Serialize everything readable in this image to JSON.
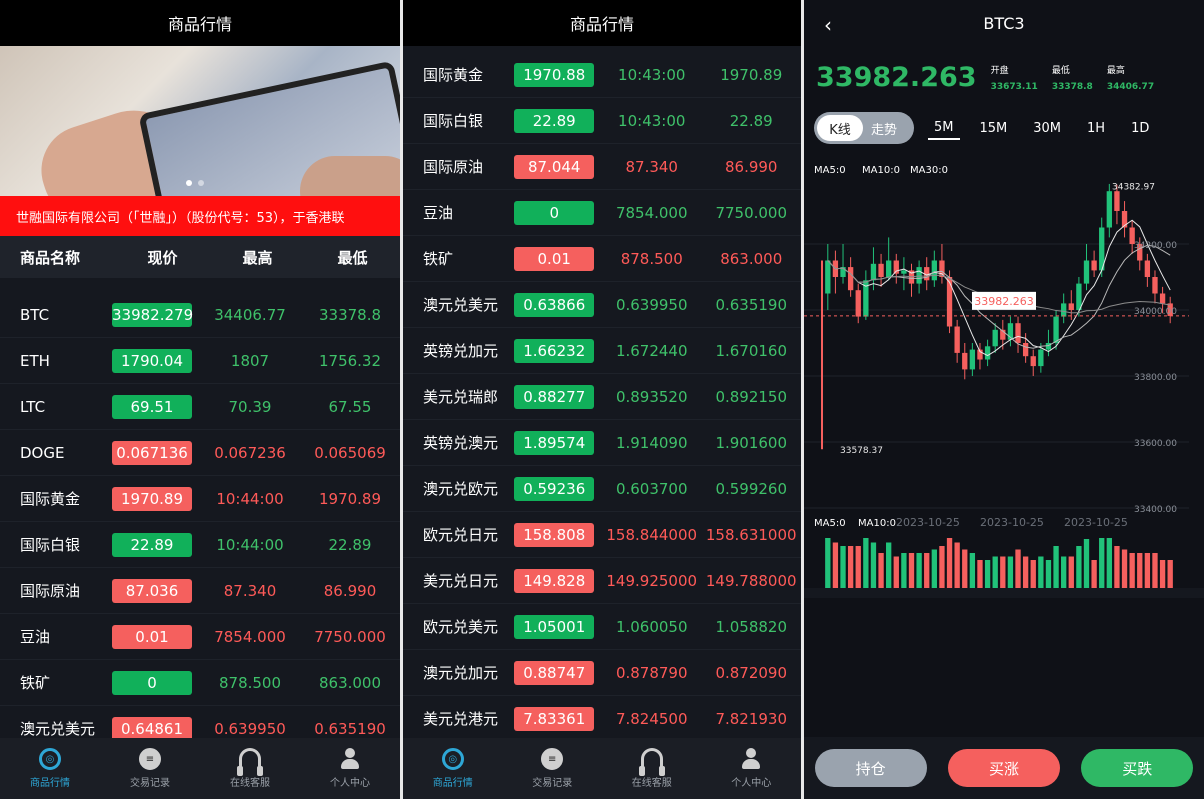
{
  "panel1": {
    "title": "商品行情",
    "marquee": "世融国际有限公司（「世融」）（股份代号：53），于香港联",
    "headers": [
      "商品名称",
      "现价",
      "最高",
      "最低"
    ],
    "rows": [
      {
        "name": "BTC",
        "price": "33982.279",
        "high": "34406.77",
        "low": "33378.8",
        "dir": "up"
      },
      {
        "name": "ETH",
        "price": "1790.04",
        "high": "1807",
        "low": "1756.32",
        "dir": "up"
      },
      {
        "name": "LTC",
        "price": "69.51",
        "high": "70.39",
        "low": "67.55",
        "dir": "up"
      },
      {
        "name": "DOGE",
        "price": "0.067136",
        "high": "0.067236",
        "low": "0.065069",
        "dir": "dn"
      },
      {
        "name": "国际黄金",
        "price": "1970.89",
        "high": "10:44:00",
        "low": "1970.89",
        "dir": "dn"
      },
      {
        "name": "国际白银",
        "price": "22.89",
        "high": "10:44:00",
        "low": "22.89",
        "dir": "up"
      },
      {
        "name": "国际原油",
        "price": "87.036",
        "high": "87.340",
        "low": "86.990",
        "dir": "dn"
      },
      {
        "name": "豆油",
        "price": "0.01",
        "high": "7854.000",
        "low": "7750.000",
        "dir": "dn"
      },
      {
        "name": "铁矿",
        "price": "0",
        "high": "878.500",
        "low": "863.000",
        "dir": "up"
      },
      {
        "name": "澳元兑美元",
        "price": "0.64861",
        "high": "0.639950",
        "low": "0.635190",
        "dir": "dn"
      }
    ]
  },
  "panel2": {
    "title": "商品行情",
    "rows": [
      {
        "name": "国际黄金",
        "price": "1970.88",
        "high": "10:43:00",
        "low": "1970.89",
        "dir": "up"
      },
      {
        "name": "国际白银",
        "price": "22.89",
        "high": "10:43:00",
        "low": "22.89",
        "dir": "up"
      },
      {
        "name": "国际原油",
        "price": "87.044",
        "high": "87.340",
        "low": "86.990",
        "dir": "dn"
      },
      {
        "name": "豆油",
        "price": "0",
        "high": "7854.000",
        "low": "7750.000",
        "dir": "up"
      },
      {
        "name": "铁矿",
        "price": "0.01",
        "high": "878.500",
        "low": "863.000",
        "dir": "dn"
      },
      {
        "name": "澳元兑美元",
        "price": "0.63866",
        "high": "0.639950",
        "low": "0.635190",
        "dir": "up"
      },
      {
        "name": "英镑兑加元",
        "price": "1.66232",
        "high": "1.672440",
        "low": "1.670160",
        "dir": "up"
      },
      {
        "name": "美元兑瑞郎",
        "price": "0.88277",
        "high": "0.893520",
        "low": "0.892150",
        "dir": "up"
      },
      {
        "name": "英镑兑澳元",
        "price": "1.89574",
        "high": "1.914090",
        "low": "1.901600",
        "dir": "up"
      },
      {
        "name": "澳元兑欧元",
        "price": "0.59236",
        "high": "0.603700",
        "low": "0.599260",
        "dir": "up"
      },
      {
        "name": "欧元兑日元",
        "price": "158.808",
        "high": "158.844000",
        "low": "158.631000",
        "dir": "dn"
      },
      {
        "name": "美元兑日元",
        "price": "149.828",
        "high": "149.925000",
        "low": "149.788000",
        "dir": "dn"
      },
      {
        "name": "欧元兑美元",
        "price": "1.05001",
        "high": "1.060050",
        "low": "1.058820",
        "dir": "up"
      },
      {
        "name": "澳元兑加元",
        "price": "0.88747",
        "high": "0.878790",
        "low": "0.872090",
        "dir": "dn"
      },
      {
        "name": "美元兑港元",
        "price": "7.83361",
        "high": "7.824500",
        "low": "7.821930",
        "dir": "dn"
      }
    ]
  },
  "tabs": [
    {
      "label": "商品行情",
      "icon": "market-icon",
      "active": true
    },
    {
      "label": "交易记录",
      "icon": "records-icon",
      "active": false
    },
    {
      "label": "在线客服",
      "icon": "headset-icon",
      "active": false
    },
    {
      "label": "个人中心",
      "icon": "user-icon",
      "active": false
    }
  ],
  "panel3": {
    "title": "BTC3",
    "price": "33982.263",
    "stats": [
      {
        "label": "开盘",
        "value": "33673.11"
      },
      {
        "label": "最低",
        "value": "33378.8"
      },
      {
        "label": "最高",
        "value": "34406.77"
      }
    ],
    "toggle": {
      "kline": "K线",
      "trend": "走势"
    },
    "timeframes": [
      "5M",
      "15M",
      "30M",
      "1H",
      "1D"
    ],
    "ma_labels": [
      "MA5:0",
      "MA10:0",
      "MA30:0"
    ],
    "vol_labels": [
      "MA5:0",
      "MA10:0"
    ],
    "chart_labels": {
      "high": "34382.97",
      "low": "33578.37",
      "current": "33982.263",
      "y_ticks": [
        "34200.00",
        "34000.00",
        "33800.00",
        "33600.00",
        "33400.00"
      ],
      "x_ticks": [
        "2023-10-25",
        "2023-10-25",
        "2023-10-25"
      ]
    },
    "buttons": {
      "hold": "持仓",
      "buy_up": "买涨",
      "buy_down": "买跌"
    }
  },
  "chart_data": {
    "type": "candlestick",
    "title": "BTC3",
    "timeframe": "5M",
    "ylim": [
      33400,
      34400
    ],
    "annotations": {
      "max": 34382.97,
      "min": 33578.37,
      "last": 33982.263
    },
    "candles": [
      {
        "o": 34050,
        "c": 34150,
        "h": 34200,
        "l": 34000
      },
      {
        "o": 34150,
        "c": 34100,
        "h": 34180,
        "l": 34050
      },
      {
        "o": 34100,
        "c": 34130,
        "h": 34200,
        "l": 34080
      },
      {
        "o": 34130,
        "c": 34060,
        "h": 34160,
        "l": 34040
      },
      {
        "o": 34060,
        "c": 33980,
        "h": 34080,
        "l": 33960
      },
      {
        "o": 33980,
        "c": 34090,
        "h": 34120,
        "l": 33970
      },
      {
        "o": 34090,
        "c": 34140,
        "h": 34190,
        "l": 34060
      },
      {
        "o": 34140,
        "c": 34100,
        "h": 34170,
        "l": 34070
      },
      {
        "o": 34100,
        "c": 34150,
        "h": 34220,
        "l": 34090
      },
      {
        "o": 34150,
        "c": 34110,
        "h": 34170,
        "l": 34080
      },
      {
        "o": 34110,
        "c": 34120,
        "h": 34160,
        "l": 34060
      },
      {
        "o": 34120,
        "c": 34080,
        "h": 34140,
        "l": 34040
      },
      {
        "o": 34080,
        "c": 34130,
        "h": 34150,
        "l": 34050
      },
      {
        "o": 34130,
        "c": 34090,
        "h": 34160,
        "l": 34060
      },
      {
        "o": 34090,
        "c": 34150,
        "h": 34180,
        "l": 34070
      },
      {
        "o": 34150,
        "c": 34100,
        "h": 34200,
        "l": 34080
      },
      {
        "o": 34100,
        "c": 33950,
        "h": 34120,
        "l": 33930
      },
      {
        "o": 33950,
        "c": 33870,
        "h": 33970,
        "l": 33840
      },
      {
        "o": 33870,
        "c": 33820,
        "h": 33900,
        "l": 33790
      },
      {
        "o": 33820,
        "c": 33880,
        "h": 33900,
        "l": 33800
      },
      {
        "o": 33880,
        "c": 33850,
        "h": 33900,
        "l": 33820
      },
      {
        "o": 33850,
        "c": 33890,
        "h": 33910,
        "l": 33830
      },
      {
        "o": 33890,
        "c": 33940,
        "h": 33960,
        "l": 33870
      },
      {
        "o": 33940,
        "c": 33910,
        "h": 33970,
        "l": 33880
      },
      {
        "o": 33910,
        "c": 33960,
        "h": 33980,
        "l": 33890
      },
      {
        "o": 33960,
        "c": 33900,
        "h": 33980,
        "l": 33870
      },
      {
        "o": 33900,
        "c": 33860,
        "h": 33930,
        "l": 33840
      },
      {
        "o": 33860,
        "c": 33830,
        "h": 33880,
        "l": 33800
      },
      {
        "o": 33830,
        "c": 33880,
        "h": 33900,
        "l": 33810
      },
      {
        "o": 33880,
        "c": 33900,
        "h": 33940,
        "l": 33860
      },
      {
        "o": 33900,
        "c": 33980,
        "h": 34000,
        "l": 33880
      },
      {
        "o": 33980,
        "c": 34020,
        "h": 34050,
        "l": 33960
      },
      {
        "o": 34020,
        "c": 34000,
        "h": 34060,
        "l": 33970
      },
      {
        "o": 34000,
        "c": 34080,
        "h": 34100,
        "l": 33980
      },
      {
        "o": 34080,
        "c": 34150,
        "h": 34200,
        "l": 34060
      },
      {
        "o": 34150,
        "c": 34120,
        "h": 34180,
        "l": 34100
      },
      {
        "o": 34120,
        "c": 34250,
        "h": 34280,
        "l": 34100
      },
      {
        "o": 34250,
        "c": 34360,
        "h": 34382,
        "l": 34220
      },
      {
        "o": 34360,
        "c": 34300,
        "h": 34380,
        "l": 34260
      },
      {
        "o": 34300,
        "c": 34250,
        "h": 34330,
        "l": 34220
      },
      {
        "o": 34250,
        "c": 34200,
        "h": 34270,
        "l": 34170
      },
      {
        "o": 34200,
        "c": 34150,
        "h": 34220,
        "l": 34120
      },
      {
        "o": 34150,
        "c": 34100,
        "h": 34170,
        "l": 34070
      },
      {
        "o": 34100,
        "c": 34050,
        "h": 34120,
        "l": 34020
      },
      {
        "o": 34050,
        "c": 34020,
        "h": 34070,
        "l": 33990
      },
      {
        "o": 34020,
        "c": 33982,
        "h": 34040,
        "l": 33960
      }
    ]
  }
}
